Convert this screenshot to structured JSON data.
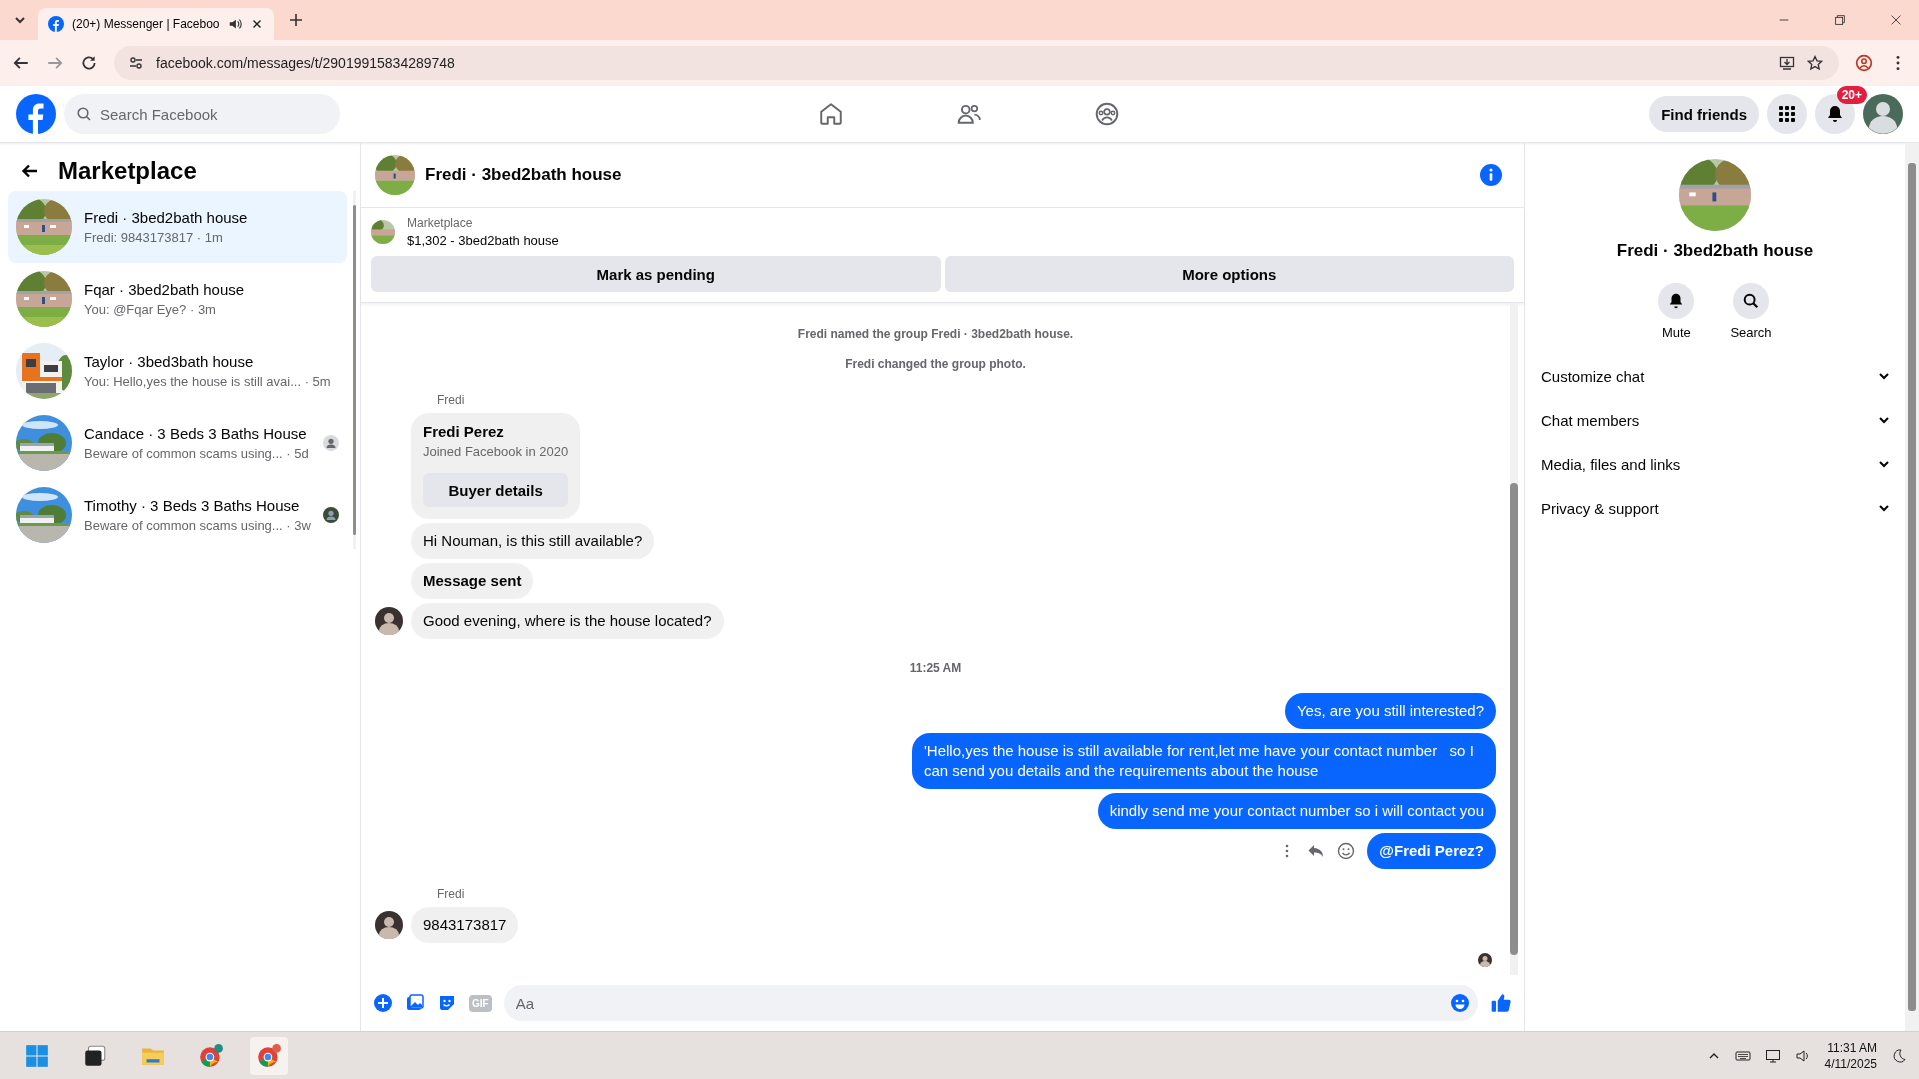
{
  "browser": {
    "tab_title": "(20+) Messenger | Faceboo",
    "url": "facebook.com/messages/t/29019915834289748"
  },
  "nav": {
    "search_placeholder": "Search Facebook",
    "find_friends": "Find friends",
    "notification_badge": "20+"
  },
  "sidebar": {
    "title": "Marketplace",
    "conversations": [
      {
        "kind": "plain",
        "title": "Fredi · 3bed2bath house",
        "preview": "Fredi: 9843173817 · 1m",
        "selected": true
      },
      {
        "kind": "plain",
        "title": "Fqar · 3bed2bath house",
        "preview": "You: @Fqar Eye? · 3m",
        "selected": false
      },
      {
        "kind": "plain",
        "title": "Taylor · 3bed3bath house",
        "preview": "You: Hello,yes the house is still avai... · 5m",
        "selected": false
      },
      {
        "kind": "generic",
        "title": "Candace · 3 Beds 3 Baths House",
        "preview": "Beware of common scams using... · 5d",
        "selected": false
      },
      {
        "title": "Timothy · 3 Beds 3 Baths House",
        "preview": "Beware of common scams using... · 3w",
        "selected": false
      }
    ]
  },
  "chat": {
    "title": "Fredi · 3bed2bath house",
    "listing": {
      "label": "Marketplace",
      "price_title": "$1,302 - 3bed2bath house"
    },
    "actions": [
      "Mark as pending",
      "More options"
    ],
    "messages": [
      {
        "kind": "system",
        "text": "Fredi named the group Fredi · 3bed2bath house."
      },
      {
        "kind": "system",
        "text": "Fredi changed the group photo."
      },
      {
        "kind": "sender",
        "text": "Fredi"
      },
      {
        "kind": "card",
        "title": "Fredi Perez",
        "subtitle": "Joined Facebook in 2020",
        "button": "Buyer details"
      },
      {
        "kind": "in",
        "text": "Hi Nouman, is this still available?",
        "bold": false,
        "avatar": false
      },
      {
        "kind": "in",
        "text": "Message sent",
        "bold": true,
        "avatar": false
      },
      {
        "kind": "in",
        "text": "Good evening, where is the house located?",
        "bold": false,
        "avatar": true
      },
      {
        "kind": "time",
        "text": "11:25 AM"
      },
      {
        "kind": "out",
        "text": "Yes, are you still interested?",
        "bold": false,
        "actions": false
      },
      {
        "kind": "out",
        "text": "'Hello,yes the house is still available for rent,let me have your contact number   so I can send you details and the requirements about the house",
        "bold": false,
        "actions": false
      },
      {
        "kind": "out",
        "text": "kindly send me your contact number so i will contact you",
        "bold": false,
        "actions": false
      },
      {
        "kind": "out",
        "text": "@Fredi Perez?",
        "bold": true,
        "actions": true
      },
      {
        "kind": "sender",
        "text": "Fredi"
      },
      {
        "kind": "in",
        "text": "9843173817",
        "bold": false,
        "avatar": true
      },
      {
        "kind": "seen"
      }
    ],
    "composer": {
      "placeholder": "Aa",
      "gif_label": "GIF"
    }
  },
  "details": {
    "title": "Fredi · 3bed2bath house",
    "buttons": [
      {
        "kind": "mute",
        "label": "Mute"
      },
      {
        "kind": "search",
        "label": "Search"
      }
    ],
    "sections": [
      {
        "label": "Customize chat",
        "expanded": false
      },
      {
        "label": "Chat members",
        "expanded": false
      },
      {
        "label": "Media, files and links",
        "expanded": false
      },
      {
        "label": "Privacy & support",
        "expanded": false
      }
    ]
  },
  "taskbar": {
    "time": "11:31 AM",
    "date": "4/11/2025"
  }
}
